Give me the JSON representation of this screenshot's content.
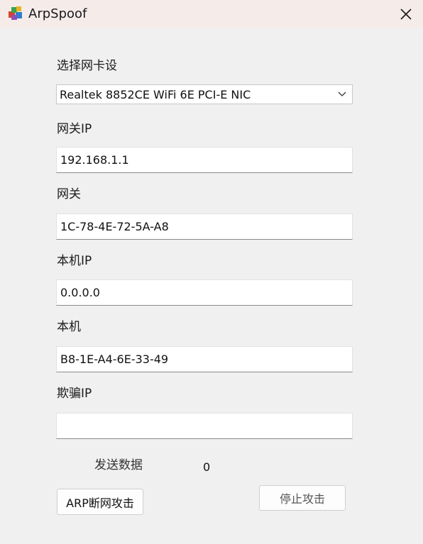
{
  "window": {
    "title": "ArpSpoof",
    "app_icon": "arpspoof-app-icon",
    "close_icon": "close-icon"
  },
  "form": {
    "nic_label": "选择网卡设",
    "nic_selected": "Realtek 8852CE WiFi 6E PCI-E NIC",
    "gateway_ip_label": "网关IP",
    "gateway_ip_value": "192.168.1.1",
    "gateway_mac_label": "网关",
    "gateway_mac_value": "1C-78-4E-72-5A-A8",
    "local_ip_label": "本机IP",
    "local_ip_value": "0.0.0.0",
    "local_mac_label": "本机",
    "local_mac_value": "B8-1E-A4-6E-33-49",
    "spoof_ip_label": "欺骗IP",
    "spoof_ip_value": ""
  },
  "stats": {
    "sent_label": "发送数据",
    "sent_count": "0"
  },
  "buttons": {
    "attack_label": "ARP断网攻击",
    "stop_label": "停止攻击"
  }
}
